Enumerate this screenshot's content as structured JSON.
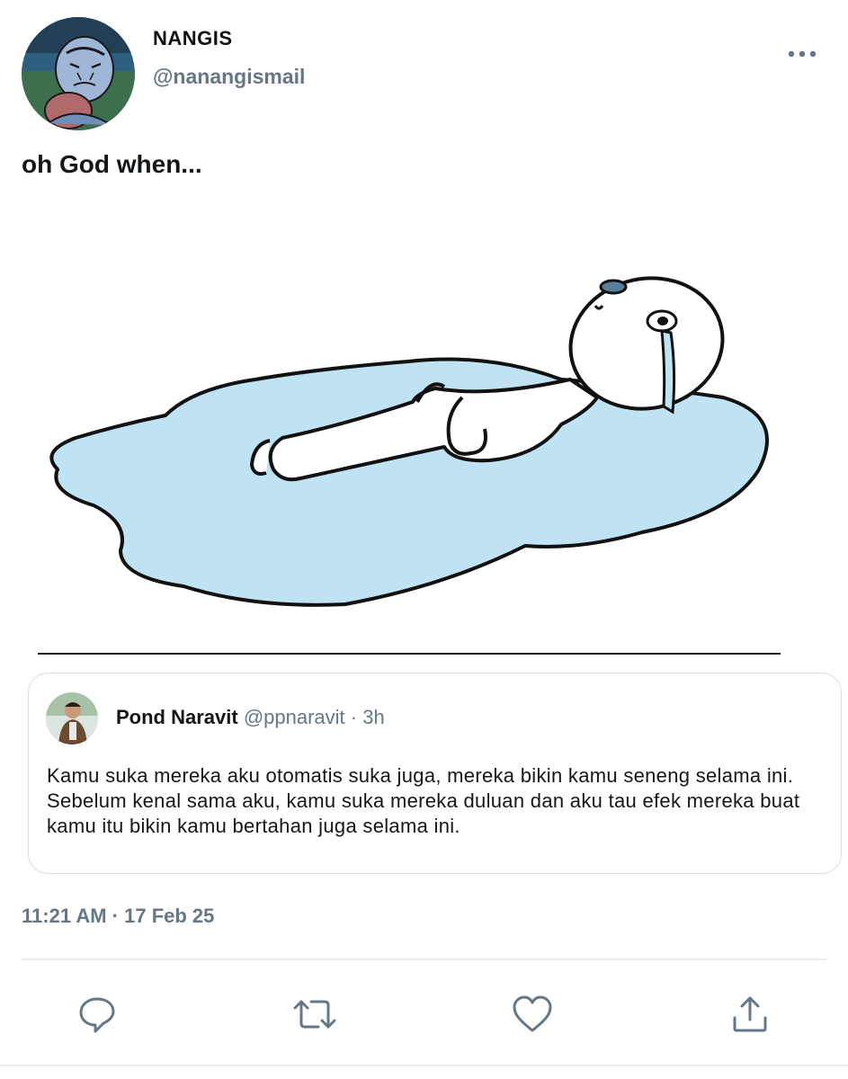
{
  "tweet": {
    "display_name": "NANGIS",
    "handle": "@nanangismail",
    "text": "oh God when...",
    "timestamp": "11:21 AM · 17 Feb 25"
  },
  "quote": {
    "name": "Pond Naravit",
    "meta": " @ppnaravit · 3h",
    "text": "Kamu suka mereka aku otomatis suka juga, mereka bikin kamu seneng selama ini. Sebelum kenal sama aku, kamu suka mereka duluan dan aku tau efek mereka buat kamu itu bikin kamu bertahan juga selama ini."
  },
  "icons": {
    "more": "more-icon",
    "reply": "reply-icon",
    "retweet": "retweet-icon",
    "like": "like-icon",
    "share": "share-icon"
  },
  "colors": {
    "secondary_text": "#657786",
    "icon": "#657786",
    "divider": "#e6ecf0",
    "puddle": "#bfe3f3"
  }
}
